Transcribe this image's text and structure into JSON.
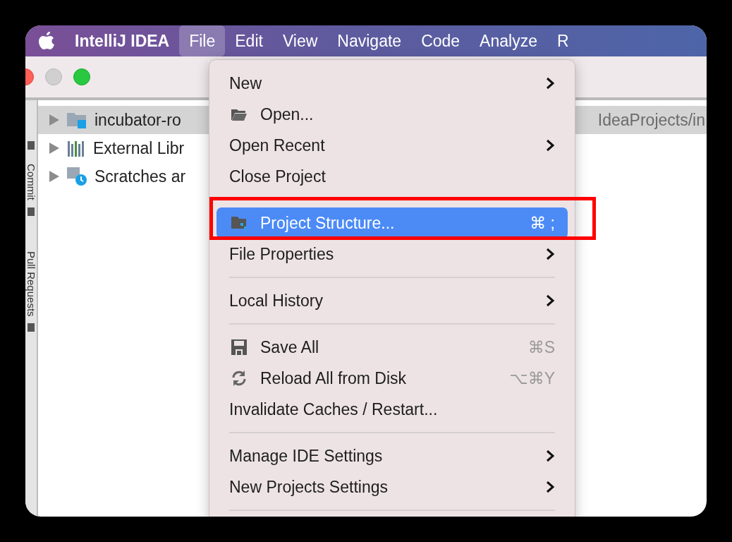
{
  "menu_bar": {
    "app_name": "IntelliJ IDEA",
    "menus": [
      {
        "label": "File",
        "selected": true
      },
      {
        "label": "Edit",
        "selected": false
      },
      {
        "label": "View",
        "selected": false
      },
      {
        "label": "Navigate",
        "selected": false
      },
      {
        "label": "Code",
        "selected": false
      },
      {
        "label": "Analyze",
        "selected": false
      },
      {
        "label": "R",
        "selected": false
      }
    ]
  },
  "side_strip": {
    "tabs": [
      "Commit",
      "Pull Requests"
    ]
  },
  "project_tree": {
    "rows": [
      {
        "label": "incubator-ro",
        "path": "IdeaProjects/in",
        "kind": "module",
        "selected": true
      },
      {
        "label": "External Libr",
        "kind": "library",
        "selected": false
      },
      {
        "label": "Scratches ar",
        "kind": "scratches",
        "selected": false
      }
    ]
  },
  "file_menu": {
    "items": [
      {
        "kind": "item",
        "label": "New",
        "submenu": true,
        "selected": false
      },
      {
        "kind": "folder",
        "label": "Open...",
        "submenu": false,
        "selected": false
      },
      {
        "kind": "item",
        "label": "Open Recent",
        "submenu": true,
        "selected": false
      },
      {
        "kind": "item",
        "label": "Close Project",
        "submenu": false,
        "selected": false
      },
      {
        "kind": "separator"
      },
      {
        "kind": "project",
        "label": "Project Structure...",
        "shortcut": "⌘ ;",
        "submenu": false,
        "selected": true,
        "highlighted": true
      },
      {
        "kind": "item",
        "label": "File Properties",
        "submenu": true,
        "selected": false
      },
      {
        "kind": "separator"
      },
      {
        "kind": "item",
        "label": "Local History",
        "submenu": true,
        "selected": false
      },
      {
        "kind": "separator"
      },
      {
        "kind": "save",
        "label": "Save All",
        "shortcut": "⌘S",
        "submenu": false,
        "selected": false
      },
      {
        "kind": "reload",
        "label": "Reload All from Disk",
        "shortcut": "⌥⌘Y",
        "submenu": false,
        "selected": false
      },
      {
        "kind": "item",
        "label": "Invalidate Caches / Restart...",
        "submenu": false,
        "selected": false
      },
      {
        "kind": "separator"
      },
      {
        "kind": "item",
        "label": "Manage IDE Settings",
        "submenu": true,
        "selected": false
      },
      {
        "kind": "item",
        "label": "New Projects Settings",
        "submenu": true,
        "selected": false
      },
      {
        "kind": "separator"
      }
    ]
  }
}
